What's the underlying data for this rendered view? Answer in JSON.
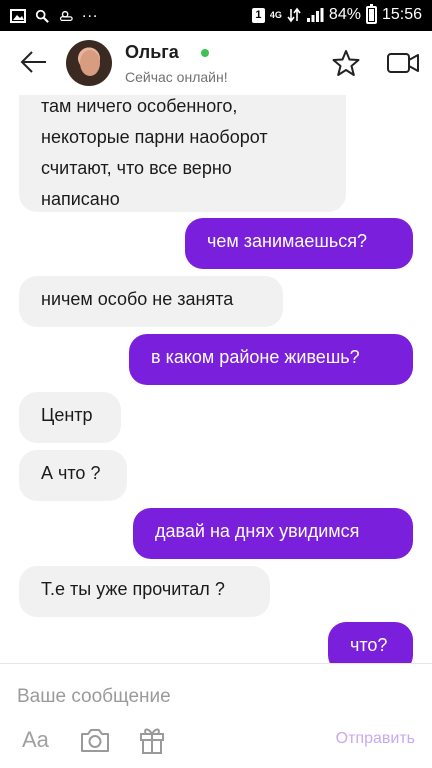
{
  "status_bar": {
    "sim": "1",
    "network": "4G",
    "battery": "84%",
    "battery_level": 0.84,
    "time": "15:56",
    "dots": "..."
  },
  "header": {
    "back_icon": "arrow-left-icon",
    "contact_name": "Ольга",
    "status": "Сейчас онлайн!",
    "online_color": "#3fc153",
    "favorite_icon": "star-icon",
    "video_icon": "video-camera-icon"
  },
  "messages": [
    {
      "side": "in",
      "text": "там ничего особенного,\nнекоторые парни наоборот\nсчитают, что все верно\nнаписано"
    },
    {
      "side": "out",
      "text": "чем занимаешься?"
    },
    {
      "side": "in",
      "text": "ничем особо не занята"
    },
    {
      "side": "out",
      "text": "в каком районе живешь?"
    },
    {
      "side": "in",
      "text": "Центр"
    },
    {
      "side": "in",
      "text": "А что ?"
    },
    {
      "side": "out",
      "text": "давай на днях увидимся"
    },
    {
      "side": "in",
      "text": "Т.е ты уже прочитал ?"
    },
    {
      "side": "out",
      "text": "что?"
    }
  ],
  "colors": {
    "outgoing_bubble": "#7a1fdc",
    "incoming_bubble": "#f1f1f2",
    "send_label": "#c9a9ef"
  },
  "composer": {
    "placeholder": "Ваше сообщение",
    "format_label": "Aa",
    "camera_icon": "camera-icon",
    "gift_icon": "gift-icon",
    "send_label": "Отправить"
  }
}
